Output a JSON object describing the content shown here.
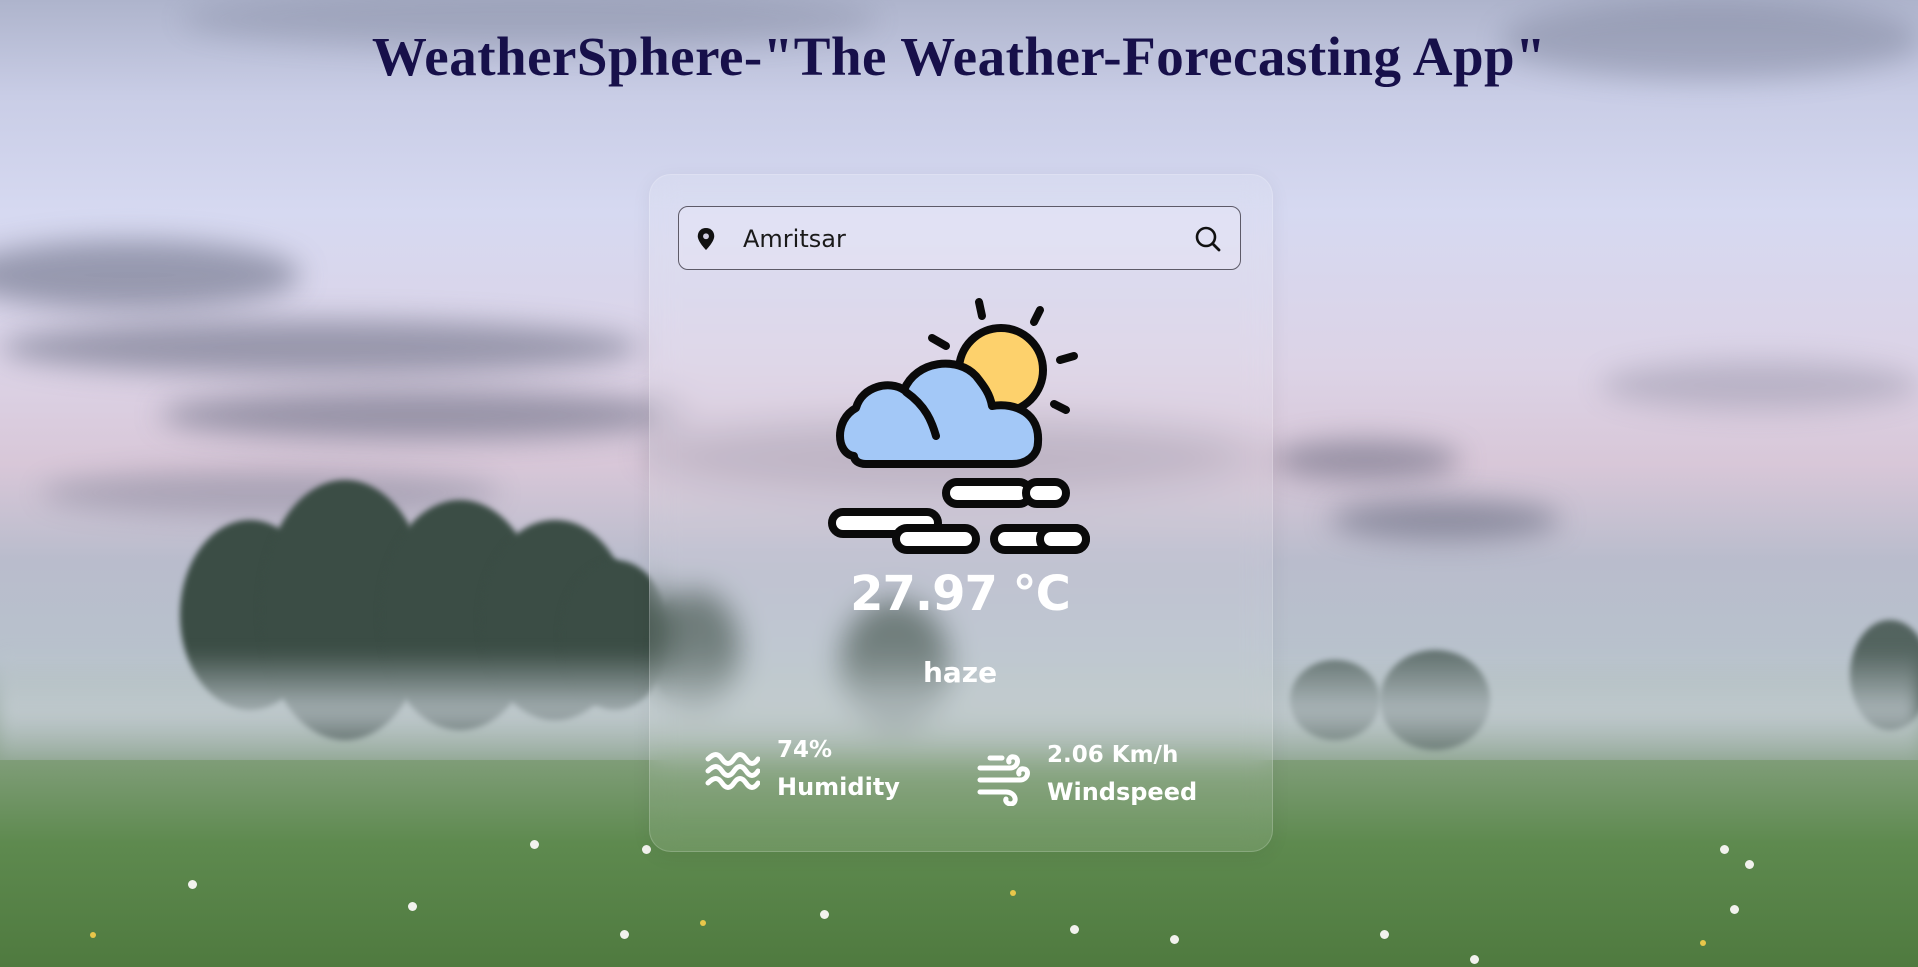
{
  "app": {
    "title": "WeatherSphere-\"The Weather-Forecasting App\""
  },
  "search": {
    "value": "Amritsar",
    "icon": "search-icon",
    "location_icon": "location-pin-icon"
  },
  "weather": {
    "icon": "partly-cloudy-windy-icon",
    "temperature": "27.97 °C",
    "description": "haze"
  },
  "details": {
    "humidity": {
      "value": "74%",
      "label": "Humidity",
      "icon": "humidity-waves-icon"
    },
    "wind": {
      "value": "2.06 Km/h",
      "label": "Windspeed",
      "icon": "wind-icon"
    }
  },
  "colors": {
    "title": "#17104a",
    "text": "#ffffff",
    "cloud_fill": "#a3c8f7",
    "sun_fill": "#fdd16c",
    "outline": "#0a0a0a"
  }
}
